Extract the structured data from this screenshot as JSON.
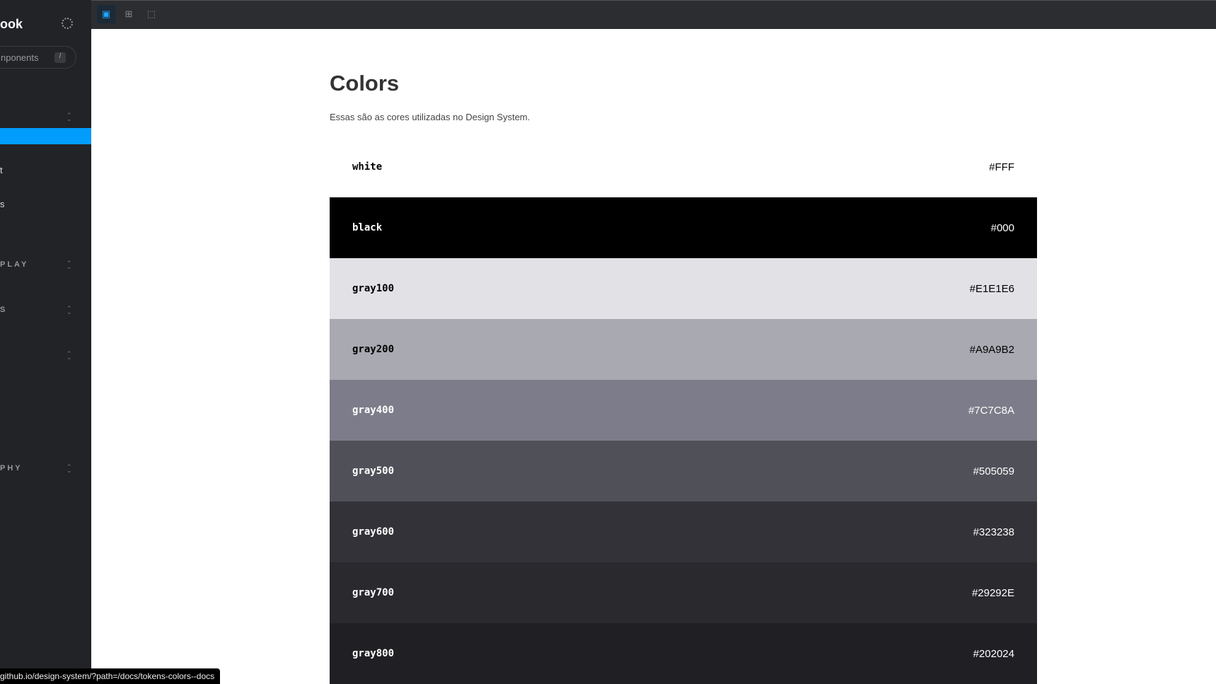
{
  "sidebar": {
    "brand": "ook",
    "search_placeholder": "nponents",
    "search_shortcut": "/",
    "items": [
      "t",
      "s"
    ],
    "groups": [
      "PLAY",
      "S",
      "",
      "PHY"
    ]
  },
  "main": {
    "title": "Colors",
    "description": "Essas são as cores utilizadas no Design System.",
    "colors": [
      {
        "name": "white",
        "hex": "#FFF",
        "bg": "#FFFFFF",
        "fg": "#000000"
      },
      {
        "name": "black",
        "hex": "#000",
        "bg": "#000000",
        "fg": "#FFFFFF"
      },
      {
        "name": "gray100",
        "hex": "#E1E1E6",
        "bg": "#E1E1E6",
        "fg": "#000000"
      },
      {
        "name": "gray200",
        "hex": "#A9A9B2",
        "bg": "#A9A9B2",
        "fg": "#000000"
      },
      {
        "name": "gray400",
        "hex": "#7C7C8A",
        "bg": "#7C7C8A",
        "fg": "#FFFFFF"
      },
      {
        "name": "gray500",
        "hex": "#505059",
        "bg": "#505059",
        "fg": "#FFFFFF"
      },
      {
        "name": "gray600",
        "hex": "#323238",
        "bg": "#323238",
        "fg": "#FFFFFF"
      },
      {
        "name": "gray700",
        "hex": "#29292E",
        "bg": "#29292E",
        "fg": "#FFFFFF"
      },
      {
        "name": "gray800",
        "hex": "#202024",
        "bg": "#202024",
        "fg": "#FFFFFF"
      }
    ]
  },
  "status_url": "github.io/design-system/?path=/docs/tokens-colors--docs"
}
